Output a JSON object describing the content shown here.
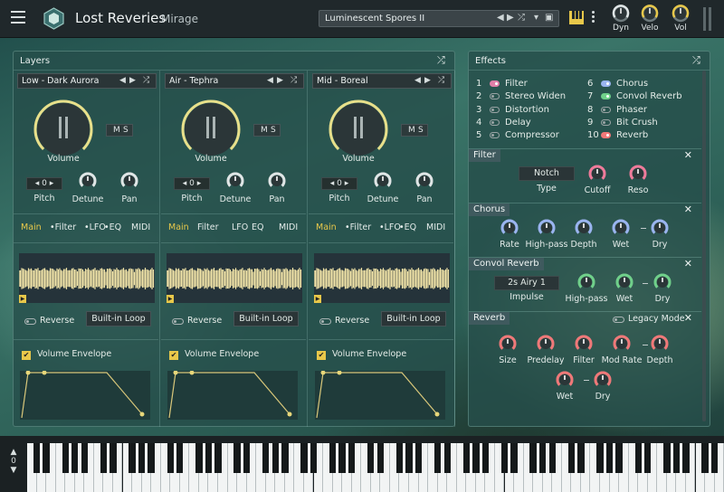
{
  "header": {
    "app_name": "Lost Reveries",
    "app_sub": "Mirage",
    "preset": "Luminescent Spores II",
    "knobs": [
      {
        "label": "Dyn",
        "color": "#e0e6e7"
      },
      {
        "label": "Velo",
        "color": "#e8c84a"
      },
      {
        "label": "Vol",
        "color": "#e8c84a"
      }
    ]
  },
  "layers_panel": {
    "title": "Layers"
  },
  "layers": [
    {
      "name": "Low - Dark Aurora",
      "volume_label": "Volume",
      "m": "M",
      "s": "S",
      "pitch_value": "0",
      "pitch_label": "Pitch",
      "detune_label": "Detune",
      "pan_label": "Pan",
      "tabs": [
        "Main",
        "•Filter",
        "•LFO",
        "•EQ",
        "MIDI"
      ],
      "reverse_label": "Reverse",
      "loop_label": "Built-in Loop",
      "env_label": "Volume Envelope"
    },
    {
      "name": "Air - Tephra",
      "volume_label": "Volume",
      "m": "M",
      "s": "S",
      "pitch_value": "0",
      "pitch_label": "Pitch",
      "detune_label": "Detune",
      "pan_label": "Pan",
      "tabs": [
        "Main",
        "Filter",
        "LFO",
        "EQ",
        "MIDI"
      ],
      "reverse_label": "Reverse",
      "loop_label": "Built-in Loop",
      "env_label": "Volume Envelope"
    },
    {
      "name": "Mid - Boreal",
      "volume_label": "Volume",
      "m": "M",
      "s": "S",
      "pitch_value": "0",
      "pitch_label": "Pitch",
      "detune_label": "Detune",
      "pan_label": "Pan",
      "tabs": [
        "Main",
        "•Filter",
        "•LFO",
        "•EQ",
        "MIDI"
      ],
      "reverse_label": "Reverse",
      "loop_label": "Built-in Loop",
      "env_label": "Volume Envelope"
    }
  ],
  "effects": {
    "title": "Effects",
    "slots": [
      {
        "num": "1",
        "name": "Filter",
        "color": "#e07fa8"
      },
      {
        "num": "2",
        "name": "Stereo Widen",
        "color": ""
      },
      {
        "num": "3",
        "name": "Distortion",
        "color": ""
      },
      {
        "num": "4",
        "name": "Delay",
        "color": ""
      },
      {
        "num": "5",
        "name": "Compressor",
        "color": ""
      },
      {
        "num": "6",
        "name": "Chorus",
        "color": "#9ab4f0"
      },
      {
        "num": "7",
        "name": "Convol Reverb",
        "color": "#6fd08a"
      },
      {
        "num": "8",
        "name": "Phaser",
        "color": ""
      },
      {
        "num": "9",
        "name": "Bit Crush",
        "color": ""
      },
      {
        "num": "10",
        "name": "Reverb",
        "color": "#f07878"
      }
    ],
    "filter": {
      "title": "Filter",
      "type_value": "Notch",
      "type_label": "Type",
      "knobs": [
        "Cutoff",
        "Reso"
      ]
    },
    "chorus": {
      "title": "Chorus",
      "knobs": [
        "Rate",
        "High-pass",
        "Depth",
        "Wet",
        "Dry"
      ]
    },
    "convol": {
      "title": "Convol Reverb",
      "impulse_value": "2s Airy 1",
      "impulse_label": "Impulse",
      "knobs": [
        "High-pass",
        "Wet",
        "Dry"
      ]
    },
    "reverb": {
      "title": "Reverb",
      "legacy_label": "Legacy Mode",
      "knobs": [
        "Size",
        "Predelay",
        "Filter",
        "Mod Rate",
        "Depth",
        "Wet",
        "Dry"
      ]
    }
  },
  "keyboard": {
    "octave": "0"
  }
}
